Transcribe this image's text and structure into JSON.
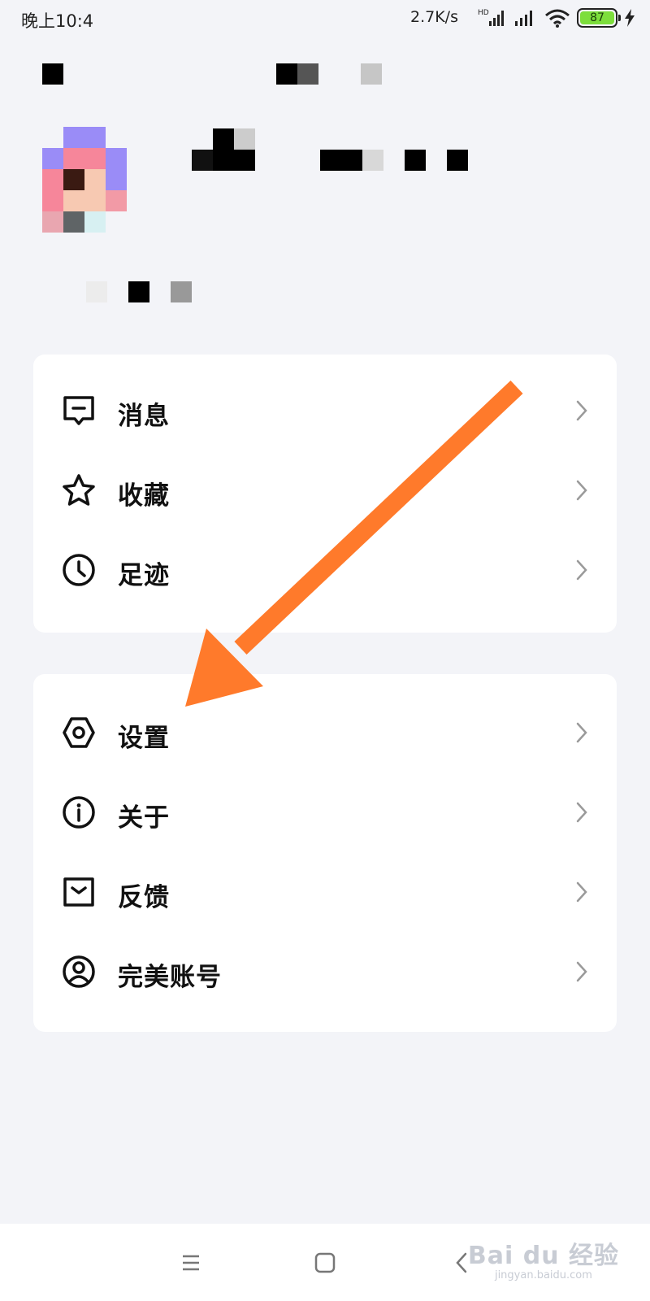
{
  "status_bar": {
    "time": "晚上10:4",
    "net_speed": "2.7K/s",
    "network_type": "HD",
    "battery_level": "87",
    "battery_color": "#7dde3c"
  },
  "profile": {
    "name_redacted": true,
    "subtitle_redacted": true
  },
  "menu_group_1": [
    {
      "label": "消息",
      "icon": "message-icon"
    },
    {
      "label": "收藏",
      "icon": "star-icon"
    },
    {
      "label": "足迹",
      "icon": "clock-icon"
    }
  ],
  "menu_group_2": [
    {
      "label": "设置",
      "icon": "settings-icon"
    },
    {
      "label": "关于",
      "icon": "info-icon"
    },
    {
      "label": "反馈",
      "icon": "mail-icon"
    },
    {
      "label": "完美账号",
      "icon": "account-icon"
    }
  ],
  "annotation": {
    "arrow_color": "#ff7a2b"
  },
  "nav_bar": {
    "buttons": [
      "menu-icon",
      "home-icon",
      "back-icon"
    ]
  },
  "watermark": {
    "top": "Bai du 经验",
    "bottom": "jingyan.baidu.com"
  },
  "colors": {
    "background": "#f3f4f8",
    "card": "#ffffff",
    "text": "#111111",
    "chevron": "#9a9a9a"
  }
}
